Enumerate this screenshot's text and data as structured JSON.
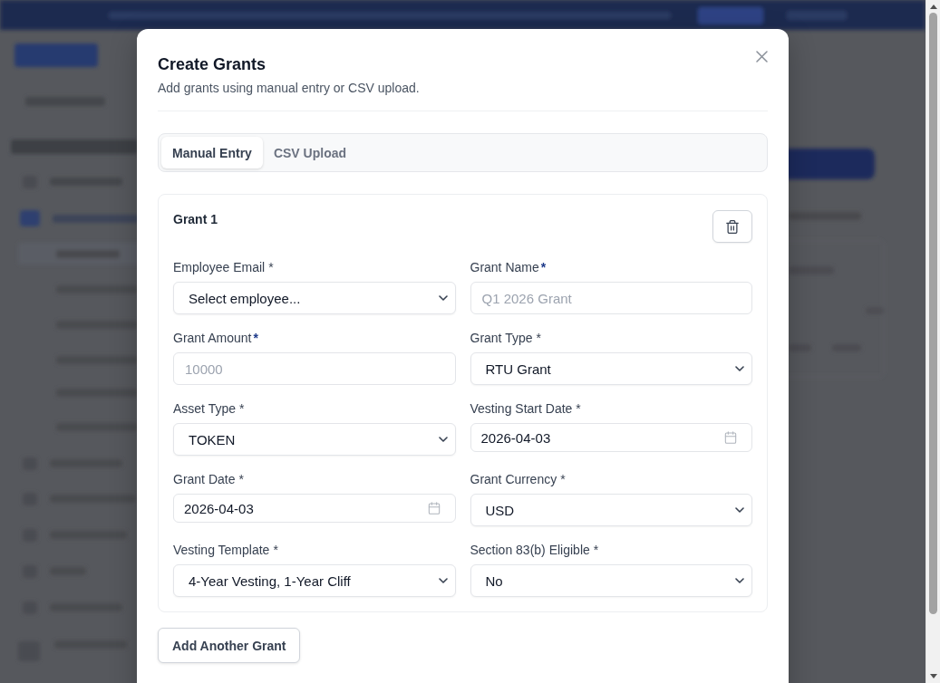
{
  "dialog": {
    "title": "Create Grants",
    "subtitle": "Add grants using manual entry or CSV upload.",
    "tabs": [
      {
        "label": "Manual Entry",
        "selected": true
      },
      {
        "label": "CSV Upload",
        "selected": false
      }
    ],
    "grants": [
      {
        "title": "Grant 1",
        "fields": [
          {
            "label": "Employee Email",
            "required_mark": {
              "text": "*",
              "kind": "plain"
            },
            "kind": "select",
            "value": "Select employee..."
          },
          {
            "label": "Grant Name",
            "required_mark": {
              "text": "*",
              "kind": "accent"
            },
            "kind": "text",
            "placeholder": "Q1 2026 Grant"
          },
          {
            "label": "Grant Amount",
            "required_mark": {
              "text": "*",
              "kind": "accent"
            },
            "kind": "text",
            "placeholder": "10000"
          },
          {
            "label": "Grant Type",
            "required_mark": {
              "text": "*",
              "kind": "plain"
            },
            "kind": "select",
            "value": "RTU Grant"
          },
          {
            "label": "Asset Type",
            "required_mark": {
              "text": "*",
              "kind": "plain"
            },
            "kind": "select",
            "value": "TOKEN"
          },
          {
            "label": "Vesting Start Date",
            "required_mark": {
              "text": "*",
              "kind": "plain"
            },
            "kind": "date",
            "value": "2026-04-03"
          },
          {
            "label": "Grant Date",
            "required_mark": {
              "text": "*",
              "kind": "plain"
            },
            "kind": "date",
            "value": "2026-04-03"
          },
          {
            "label": "Grant Currency",
            "required_mark": {
              "text": "*",
              "kind": "plain"
            },
            "kind": "select",
            "value": "USD"
          },
          {
            "label": "Vesting Template",
            "required_mark": {
              "text": "*",
              "kind": "plain"
            },
            "kind": "select",
            "value": "4-Year Vesting, 1-Year Cliff"
          },
          {
            "label": "Section 83(b) Eligible",
            "required_mark": {
              "text": "*",
              "kind": "plain"
            },
            "kind": "select",
            "value": "No"
          }
        ]
      }
    ],
    "add_button": "Add Another Grant"
  }
}
